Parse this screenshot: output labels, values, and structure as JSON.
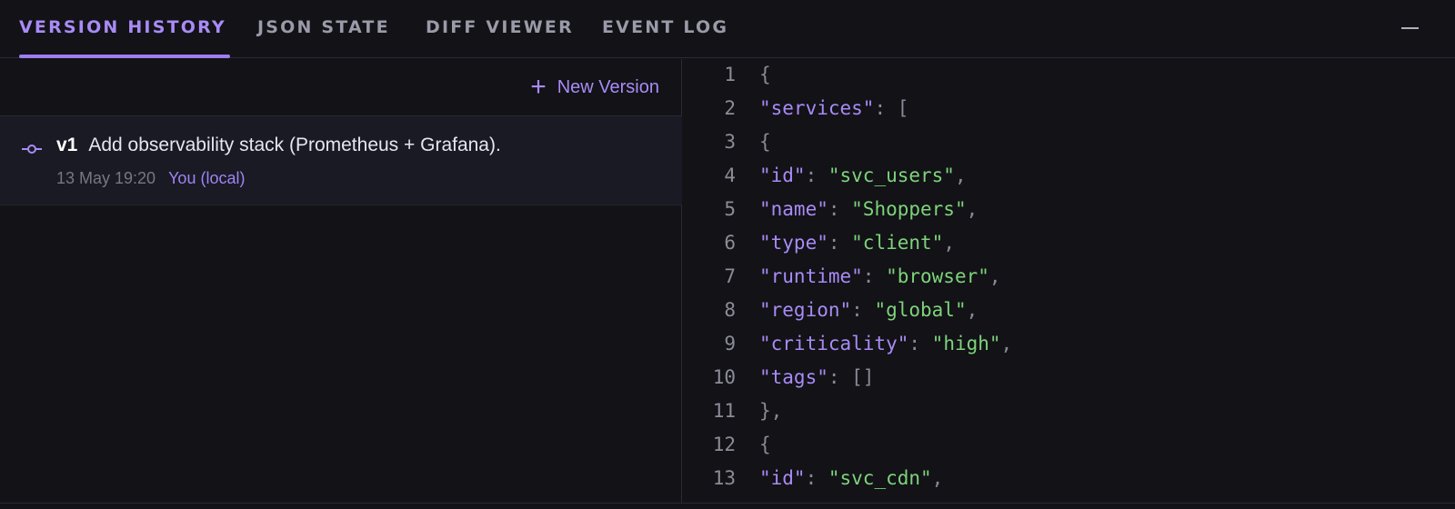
{
  "tabs": [
    {
      "label": "VERSION HISTORY",
      "active": true
    },
    {
      "label": "JSON STATE",
      "active": false
    },
    {
      "label": "DIFF VIEWER",
      "active": false
    },
    {
      "label": "EVENT LOG",
      "active": false
    }
  ],
  "window": {
    "minimize_icon": "minus-icon"
  },
  "toolbar": {
    "new_version_label": "New Version",
    "new_version_icon": "plus-icon"
  },
  "versions": [
    {
      "tag": "v1",
      "message": "Add observability stack (Prometheus + Grafana).",
      "date": "13 May 19:20",
      "author": "You (local)",
      "icon": "commit-icon"
    }
  ],
  "code": {
    "lines": [
      {
        "n": "1",
        "parts": [
          {
            "t": "{",
            "c": "punc"
          }
        ]
      },
      {
        "n": "2",
        "parts": [
          {
            "t": "\"services\"",
            "c": "key"
          },
          {
            "t": ": [",
            "c": "punc"
          }
        ]
      },
      {
        "n": "3",
        "parts": [
          {
            "t": "{",
            "c": "punc"
          }
        ]
      },
      {
        "n": "4",
        "parts": [
          {
            "t": "\"id\"",
            "c": "key"
          },
          {
            "t": ": ",
            "c": "punc"
          },
          {
            "t": "\"svc_users\"",
            "c": "str"
          },
          {
            "t": ",",
            "c": "punc"
          }
        ]
      },
      {
        "n": "5",
        "parts": [
          {
            "t": "\"name\"",
            "c": "key"
          },
          {
            "t": ": ",
            "c": "punc"
          },
          {
            "t": "\"Shoppers\"",
            "c": "str"
          },
          {
            "t": ",",
            "c": "punc"
          }
        ]
      },
      {
        "n": "6",
        "parts": [
          {
            "t": "\"type\"",
            "c": "key"
          },
          {
            "t": ": ",
            "c": "punc"
          },
          {
            "t": "\"client\"",
            "c": "str"
          },
          {
            "t": ",",
            "c": "punc"
          }
        ]
      },
      {
        "n": "7",
        "parts": [
          {
            "t": "\"runtime\"",
            "c": "key"
          },
          {
            "t": ": ",
            "c": "punc"
          },
          {
            "t": "\"browser\"",
            "c": "str"
          },
          {
            "t": ",",
            "c": "punc"
          }
        ]
      },
      {
        "n": "8",
        "parts": [
          {
            "t": "\"region\"",
            "c": "key"
          },
          {
            "t": ": ",
            "c": "punc"
          },
          {
            "t": "\"global\"",
            "c": "str"
          },
          {
            "t": ",",
            "c": "punc"
          }
        ]
      },
      {
        "n": "9",
        "parts": [
          {
            "t": "\"criticality\"",
            "c": "key"
          },
          {
            "t": ": ",
            "c": "punc"
          },
          {
            "t": "\"high\"",
            "c": "str"
          },
          {
            "t": ",",
            "c": "punc"
          }
        ]
      },
      {
        "n": "10",
        "parts": [
          {
            "t": "\"tags\"",
            "c": "key"
          },
          {
            "t": ": []",
            "c": "punc"
          }
        ]
      },
      {
        "n": "11",
        "parts": [
          {
            "t": "},",
            "c": "punc"
          }
        ]
      },
      {
        "n": "12",
        "parts": [
          {
            "t": "{",
            "c": "punc"
          }
        ]
      },
      {
        "n": "13",
        "parts": [
          {
            "t": "\"id\"",
            "c": "key"
          },
          {
            "t": ": ",
            "c": "punc"
          },
          {
            "t": "\"svc_cdn\"",
            "c": "str"
          },
          {
            "t": ",",
            "c": "punc"
          }
        ]
      }
    ]
  },
  "colors": {
    "accent": "#a98bf5",
    "background": "#121217",
    "selected_row": "#191a24",
    "json_key": "#a98bf5",
    "json_string": "#7ed37a",
    "json_punctuation": "#8a8a96"
  }
}
